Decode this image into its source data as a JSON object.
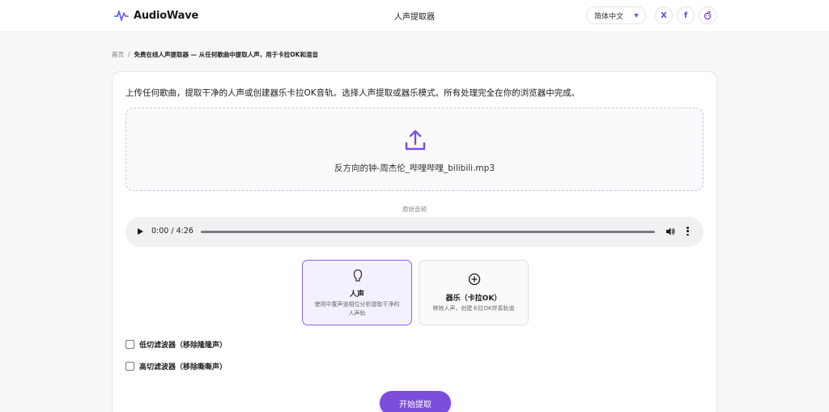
{
  "header": {
    "brand": "AudioWave",
    "title": "人声提取器",
    "language": "简体中文",
    "social": {
      "x_label": "X",
      "fb_label": "f"
    }
  },
  "breadcrumb": {
    "home": "首页",
    "separator": "/",
    "current": "免费在线人声提取器 — 从任何歌曲中提取人声，用于卡拉OK和混音"
  },
  "main": {
    "intro": "上传任何歌曲，提取干净的人声或创建器乐卡拉OK音轨。选择人声提取或器乐模式。所有处理完全在你的浏览器中完成。",
    "file_name": "反方向的钟-周杰伦_哔哩哔哩_bilibili.mp3",
    "audio_label": "原始音频",
    "player": {
      "time": "0:00 / 4:26"
    },
    "modes": [
      {
        "title": "人声",
        "desc": "使用中置声道相位分析提取干净的人声轨"
      },
      {
        "title": "器乐（卡拉OK）",
        "desc": "移除人声，创建卡拉OK伴奏轨道"
      }
    ],
    "filters": {
      "low": "低切滤波器（移除隆隆声）",
      "high": "高切滤波器（移除嘶嘶声）"
    },
    "start_button": "开始提取"
  },
  "colors": {
    "accent": "#7c4ddb",
    "accent_light": "#f5f0fe"
  },
  "icons": {
    "brand": "waveform-icon",
    "upload": "upload-icon",
    "vocals": "microphone-head-icon",
    "instrumental": "plus-circle-icon"
  }
}
